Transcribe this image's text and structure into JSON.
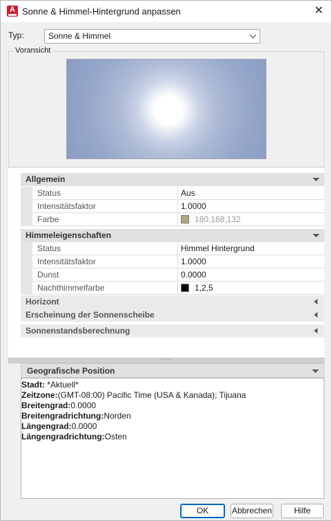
{
  "window": {
    "title": "Sonne & Himmel-Hintergrund anpassen",
    "app_icon_letter": "A",
    "close_glyph": "✕"
  },
  "type_field": {
    "label": "Typ:",
    "value": "Sonne & Himmel"
  },
  "preview": {
    "legend": "Voransicht"
  },
  "properties": {
    "allgemein": {
      "header": "Allgemein",
      "rows": [
        {
          "name": "Status",
          "value": "Aus"
        },
        {
          "name": "Intensitätsfaktor",
          "value": "1.0000"
        },
        {
          "name": "Farbe",
          "value": "180,168,132",
          "swatch": "#b4a884"
        }
      ]
    },
    "himmel": {
      "header": "Himmeleigenschaften",
      "rows": [
        {
          "name": "Status",
          "value": "Himmel Hintergrund"
        },
        {
          "name": "Intensitätsfaktor",
          "value": "1.0000"
        },
        {
          "name": "Dunst",
          "value": "0.0000"
        },
        {
          "name": "Nachthimmelfarbe",
          "value": "1,2,5",
          "swatch": "#010205"
        }
      ]
    },
    "horizont": {
      "header": "Horizont"
    },
    "erscheinung": {
      "header": "Erscheinung der Sonnenscheibe"
    },
    "sonnenstand": {
      "header": "Sonnenstandsberechnung"
    }
  },
  "splitter_glyph": "·····",
  "geo": {
    "header": "Geografische Position",
    "lines": [
      {
        "label": "Stadt:",
        "value": " *Aktuell*"
      },
      {
        "label": "Zeitzone:",
        "value": "(GMT-08:00) Pacific Time (USA & Kanada); Tijuana"
      },
      {
        "label": "Breitengrad:",
        "value": "0.0000"
      },
      {
        "label": "Breitengradrichtung:",
        "value": "Norden"
      },
      {
        "label": "Längengrad:",
        "value": "0.0000"
      },
      {
        "label": "Längengradrichtung:",
        "value": "Osten"
      }
    ]
  },
  "buttons": {
    "ok": "OK",
    "cancel": "Abbrechen",
    "help": "Hilfe"
  },
  "colors": {
    "accent": "#0067c0",
    "app_icon": "#c8202e"
  }
}
